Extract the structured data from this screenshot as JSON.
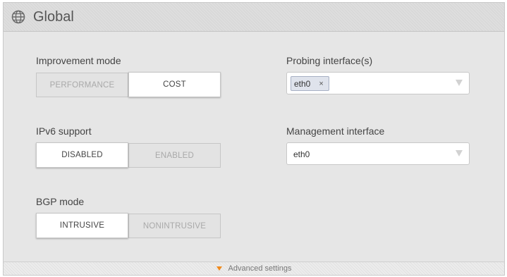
{
  "panel": {
    "title": "Global",
    "icon": "globe-icon"
  },
  "improvement_mode": {
    "label": "Improvement mode",
    "options": [
      "PERFORMANCE",
      "COST"
    ],
    "selected": "COST"
  },
  "ipv6_support": {
    "label": "IPv6 support",
    "options": [
      "DISABLED",
      "ENABLED"
    ],
    "selected": "DISABLED"
  },
  "bgp_mode": {
    "label": "BGP mode",
    "options": [
      "INTRUSIVE",
      "NONINTRUSIVE"
    ],
    "selected": "INTRUSIVE"
  },
  "probing_interfaces": {
    "label": "Probing interface(s)",
    "chips": [
      {
        "value": "eth0",
        "remove": "×"
      }
    ]
  },
  "management_interface": {
    "label": "Management interface",
    "value": "eth0"
  },
  "footer": {
    "advanced_label": "Advanced settings"
  },
  "colors": {
    "accent_arrow": "#f08a1d",
    "chip_bg": "#dfe3ec"
  }
}
